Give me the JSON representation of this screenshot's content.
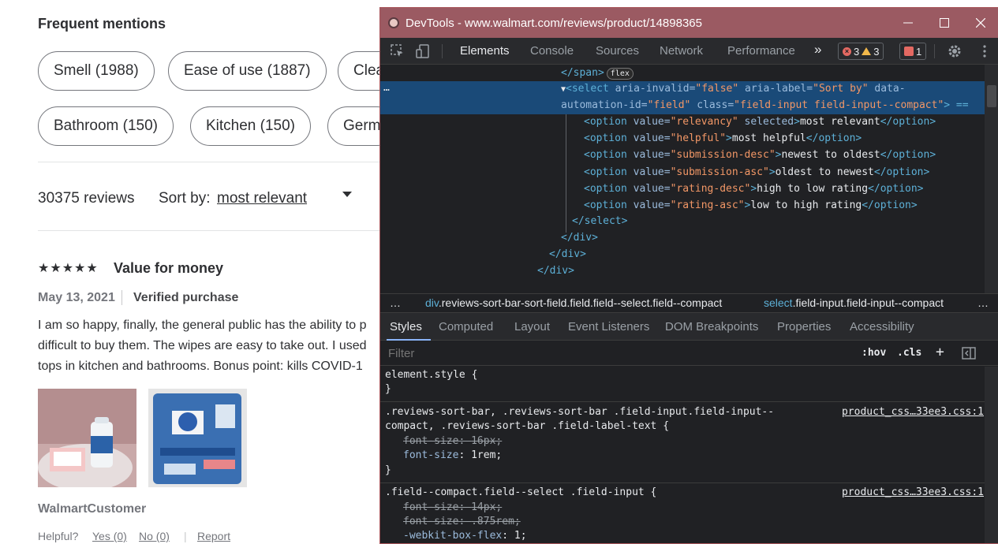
{
  "page": {
    "frequent_mentions_title": "Frequent mentions",
    "chips": [
      {
        "label": "Smell (1988)"
      },
      {
        "label": "Ease of use (1887)"
      },
      {
        "label": "Clea"
      },
      {
        "label": "Bathroom (150)"
      },
      {
        "label": "Kitchen (150)"
      },
      {
        "label": "Germ"
      }
    ],
    "reviews_count": "30375 reviews",
    "sort_label": "Sort by:",
    "sort_value": "most relevant",
    "review": {
      "stars": "★★★★★",
      "rating": 5,
      "title": "Value for money",
      "date": "May 13, 2021",
      "verified": "Verified purchase",
      "lines": [
        "I am so happy, finally, the general public has the ability to p",
        "difficult to buy them. The wipes are easy to take out. I used",
        "tops in kitchen and bathrooms. Bonus point: kills COVID-1"
      ],
      "customer": "WalmartCustomer",
      "helpful_label": "Helpful?",
      "yes_label": "Yes (0)",
      "no_label": "No (0)",
      "report_label": "Report"
    }
  },
  "devtools": {
    "window_title": "DevTools - www.walmart.com/reviews/product/14898365",
    "tabs": [
      "Elements",
      "Console",
      "Sources",
      "Network",
      "Performance"
    ],
    "more_tabs": "»",
    "errors": "3",
    "warnings": "3",
    "issues": "1",
    "tree": {
      "span_close": "</span>",
      "flex_badge": "flex",
      "ellipsis": "…",
      "select_open_1a": "<select",
      "select_attr_1": " aria-invalid=",
      "select_val_1": "\"false\"",
      "select_attr_2": " aria-label=",
      "select_val_2": "\"Sort by\"",
      "select_attr_3": " data-",
      "select_line2_a": "automation-id=",
      "select_line2_v1": "\"field\"",
      "select_line2_b": " class=",
      "select_line2_v2": "\"field-input field-input--compact\"",
      "select_line2_end": "> ==",
      "options": [
        {
          "value": "\"relevancy\"",
          "extra": " selected",
          "text": "most relevant"
        },
        {
          "value": "\"helpful\"",
          "extra": "",
          "text": "most helpful"
        },
        {
          "value": "\"submission-desc\"",
          "extra": "",
          "text": "newest to oldest"
        },
        {
          "value": "\"submission-asc\"",
          "extra": "",
          "text": "oldest to newest"
        },
        {
          "value": "\"rating-desc\"",
          "extra": "",
          "text": "high to low rating"
        },
        {
          "value": "\"rating-asc\"",
          "extra": "",
          "text": "low to high rating"
        }
      ],
      "select_close": "</select>",
      "div_close_1": "</div>",
      "div_close_2": "</div>",
      "div_close_3": "</div>"
    },
    "breadcrumb": {
      "ellipsis": "…",
      "crumb1_tag": "div",
      "crumb1_cls": ".reviews-sort-bar-sort-field.field.field--select.field--compact",
      "crumb2_tag": "select",
      "crumb2_cls": ".field-input.field-input--compact",
      "more": "…"
    },
    "subtabs": [
      "Styles",
      "Computed",
      "Layout",
      "Event Listeners",
      "DOM Breakpoints",
      "Properties",
      "Accessibility"
    ],
    "filter_placeholder": "Filter",
    "hov": ":hov",
    "cls": ".cls",
    "plus": "+",
    "rules": {
      "element_style": "element.style {",
      "close_brace": "}",
      "rule1_sel_1": ".reviews-sort-bar, .reviews-sort-bar .field-input.field-input--",
      "rule1_sel_2": "compact, .reviews-sort-bar .field-label-text {",
      "rule1_src": "product_css…33ee3.css:1",
      "rule1_p1_name": "font-size",
      "rule1_p1_val": "16px;",
      "rule1_p2_name": "font-size",
      "rule1_p2_val": "1rem;",
      "rule2_sel": ".field--compact.field--select .field-input {",
      "rule2_src": "product_css…33ee3.css:1",
      "rule2_p1_name": "font-size",
      "rule2_p1_val": "14px;",
      "rule2_p2_name": "font-size",
      "rule2_p2_val": ".875rem;",
      "rule2_p3_name": "-webkit-box-flex",
      "rule2_p3_val": "1;"
    }
  }
}
